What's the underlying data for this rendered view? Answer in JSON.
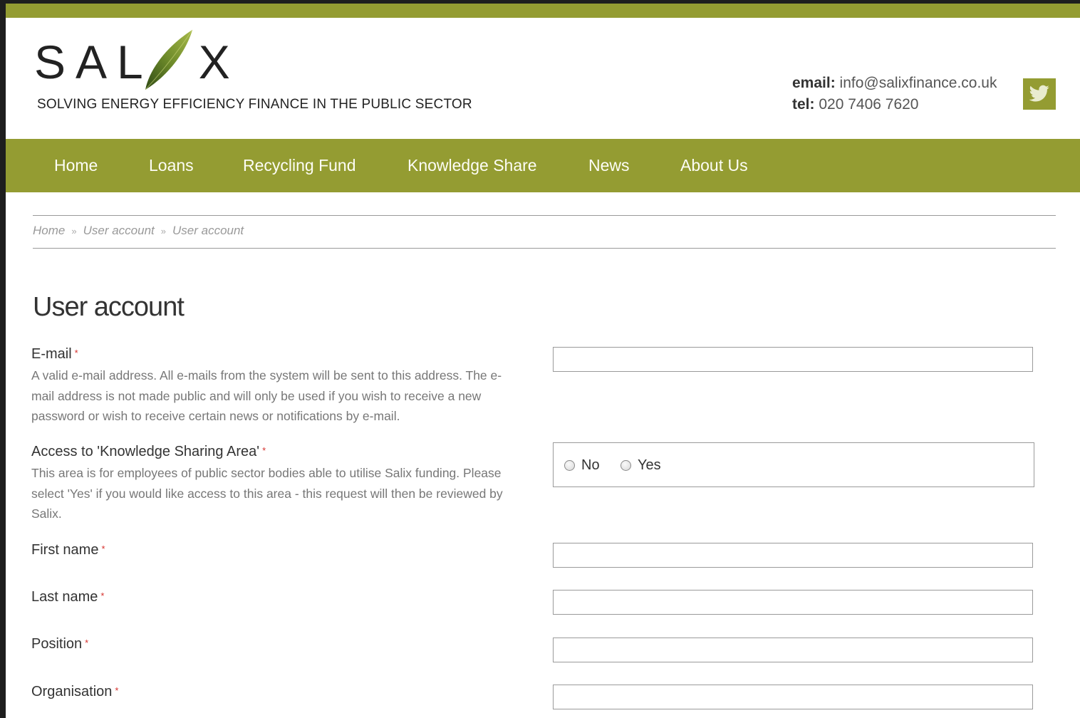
{
  "header": {
    "logo_text_left": "SAL",
    "logo_text_right": "X",
    "logo_alt": "SALIX",
    "tagline": "SOLVING ENERGY EFFICIENCY FINANCE IN THE PUBLIC SECTOR",
    "email_label": "email:",
    "email_value": "info@salixfinance.co.uk",
    "tel_label": "tel:",
    "tel_value": "020 7406 7620",
    "social_icon": "twitter-icon"
  },
  "nav": {
    "items": [
      {
        "label": "Home"
      },
      {
        "label": "Loans"
      },
      {
        "label": "Recycling Fund"
      },
      {
        "label": "Knowledge Share"
      },
      {
        "label": "News"
      },
      {
        "label": "About Us"
      }
    ]
  },
  "breadcrumb": {
    "items": [
      "Home",
      "User account",
      "User account"
    ],
    "separator": "»"
  },
  "page": {
    "title": "User account"
  },
  "form": {
    "required_marker": "*",
    "email": {
      "label": "E-mail",
      "description": "A valid e-mail address. All e-mails from the system will be sent to this address. The e-mail address is not made public and will only be used if you wish to receive a new password or wish to receive certain news or notifications by e-mail.",
      "value": ""
    },
    "access": {
      "label": "Access to 'Knowledge Sharing Area'",
      "description": "This area is for employees of public sector bodies able to utilise Salix funding. Please select 'Yes' if you would like access to this area - this request will then be reviewed by Salix.",
      "options": [
        "No",
        "Yes"
      ],
      "selected": null
    },
    "first_name": {
      "label": "First name",
      "value": ""
    },
    "last_name": {
      "label": "Last name",
      "value": ""
    },
    "position": {
      "label": "Position",
      "value": ""
    },
    "organisation": {
      "label": "Organisation",
      "value": ""
    }
  },
  "colors": {
    "brand_green": "#949c32",
    "required_red": "#d6322e",
    "leaf_dark": "#3d5a1c",
    "leaf_light": "#8fa63a"
  }
}
